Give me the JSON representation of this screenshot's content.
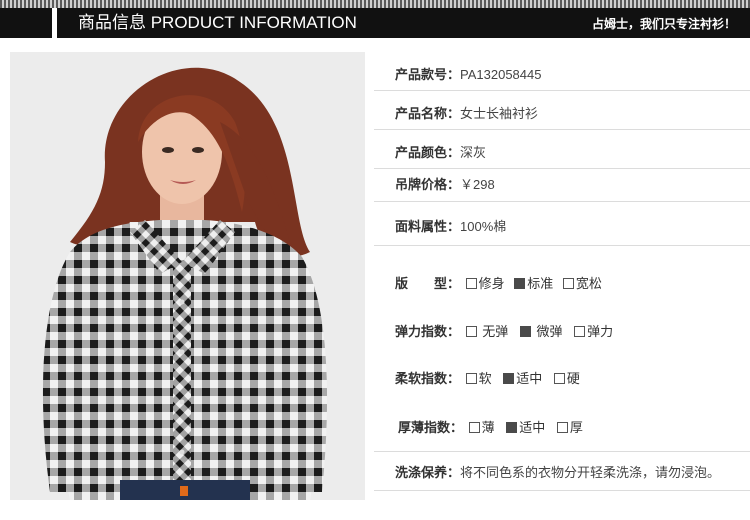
{
  "header": {
    "title": "商品信息 PRODUCT INFORMATION",
    "slogan": "占姆士，我们只专注衬衫！"
  },
  "colors": {
    "header_bg": "#111111",
    "accent_checked": "#4a4a4a",
    "shirt_dark": "#1c1c1c",
    "shirt_light": "#f2f2f2"
  },
  "product_image": {
    "icon": "plaid-shirt-model-photo"
  },
  "specs": {
    "style_no": {
      "label": "产品款号：",
      "value": "PA132058445"
    },
    "name": {
      "label": "产品名称：",
      "value": "女士长袖衬衫"
    },
    "color": {
      "label": "产品颜色：",
      "value": "深灰"
    },
    "price": {
      "label": "吊牌价格：",
      "value": "￥298"
    },
    "fabric": {
      "label": "面料属性：",
      "value": "100%棉"
    },
    "fit": {
      "label": "版　　型：",
      "options": [
        {
          "label": "修身",
          "checked": false
        },
        {
          "label": "标准",
          "checked": true
        },
        {
          "label": "宽松",
          "checked": false
        }
      ]
    },
    "elasticity": {
      "label": "弹力指数：",
      "options": [
        {
          "label": "无弹",
          "checked": false
        },
        {
          "label": "微弹",
          "checked": true
        },
        {
          "label": "弹力",
          "checked": false
        }
      ]
    },
    "softness": {
      "label": "柔软指数：",
      "options": [
        {
          "label": "软",
          "checked": false
        },
        {
          "label": "适中",
          "checked": true
        },
        {
          "label": "硬",
          "checked": false
        }
      ]
    },
    "thickness": {
      "label": "厚薄指数：",
      "options": [
        {
          "label": "薄",
          "checked": false
        },
        {
          "label": "适中",
          "checked": true
        },
        {
          "label": "厚",
          "checked": false
        }
      ]
    },
    "care": {
      "label": "洗涤保养：",
      "value": "将不同色系的衣物分开轻柔洗涤，请勿浸泡。"
    }
  }
}
